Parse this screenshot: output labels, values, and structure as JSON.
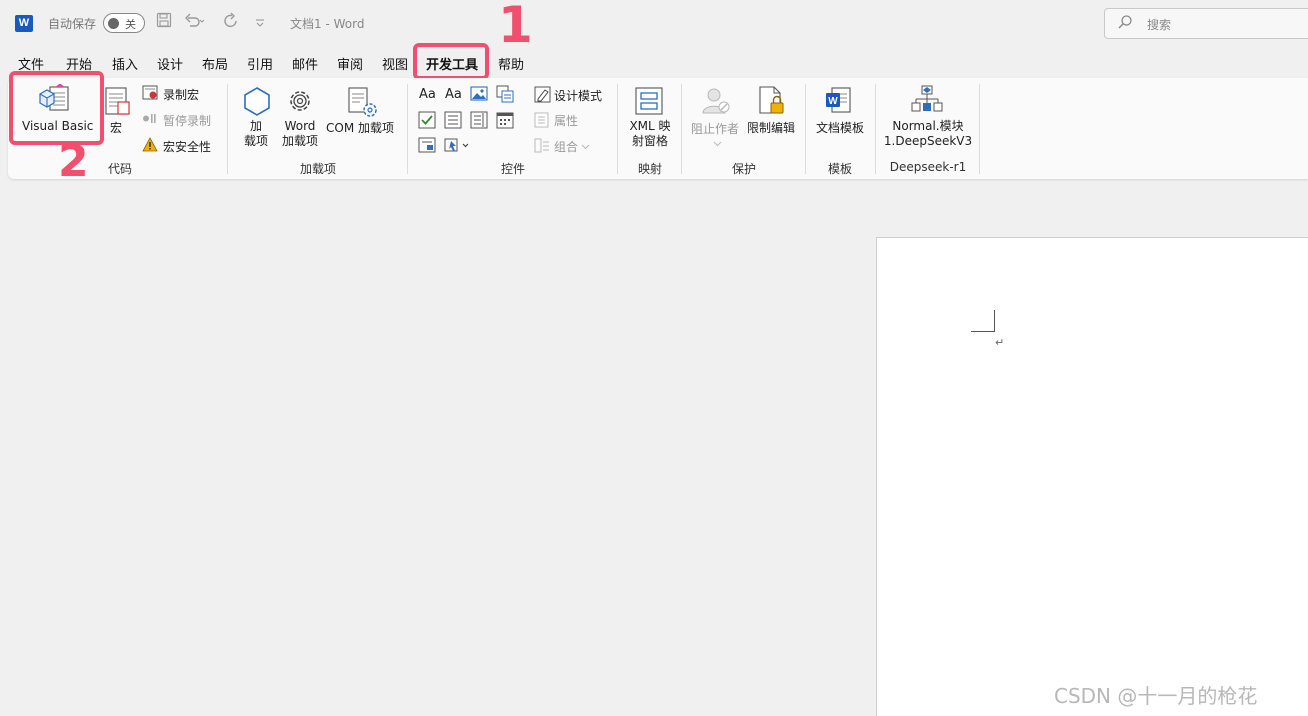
{
  "titlebar": {
    "logo_letter": "W",
    "autosave_label": "自动保存",
    "autosave_state": "关",
    "doc_title": "文档1 - Word",
    "search_placeholder": "搜索"
  },
  "tabs": [
    "文件",
    "开始",
    "插入",
    "设计",
    "布局",
    "引用",
    "邮件",
    "审阅",
    "视图",
    "开发工具",
    "帮助"
  ],
  "active_tab": "开发工具",
  "ribbon": {
    "code": {
      "label": "代码",
      "visual_basic": "Visual Basic",
      "macro": "宏",
      "record_macro": "录制宏",
      "pause_recording": "暂停录制",
      "macro_security": "宏安全性"
    },
    "addins": {
      "label": "加载项",
      "addin_line1": "加",
      "addin_line2": "载项",
      "word_line1": "Word",
      "word_line2": "加载项",
      "com": "COM 加载项"
    },
    "controls": {
      "label": "控件",
      "aa1": "Aa",
      "aa2": "Aa",
      "design_mode": "设计模式",
      "properties": "属性",
      "group": "组合"
    },
    "mapping": {
      "label": "映射",
      "xml_line1": "XML 映",
      "xml_line2": "射窗格"
    },
    "protect": {
      "label": "保护",
      "block_authors": "阻止作者",
      "restrict_editing": "限制编辑"
    },
    "templates": {
      "label": "模板",
      "doc_template": "文档模板"
    },
    "deepseek": {
      "label": "Deepseek-r1",
      "line1": "Normal.模块",
      "line2": "1.DeepSeekV3"
    }
  },
  "annotations": {
    "step1": "1",
    "step2": "2"
  },
  "document": {
    "paragraph_mark": "↵"
  },
  "watermark": "CSDN @十一月的枪花",
  "colors": {
    "accent": "#185abd",
    "highlight": "#f0506e"
  }
}
